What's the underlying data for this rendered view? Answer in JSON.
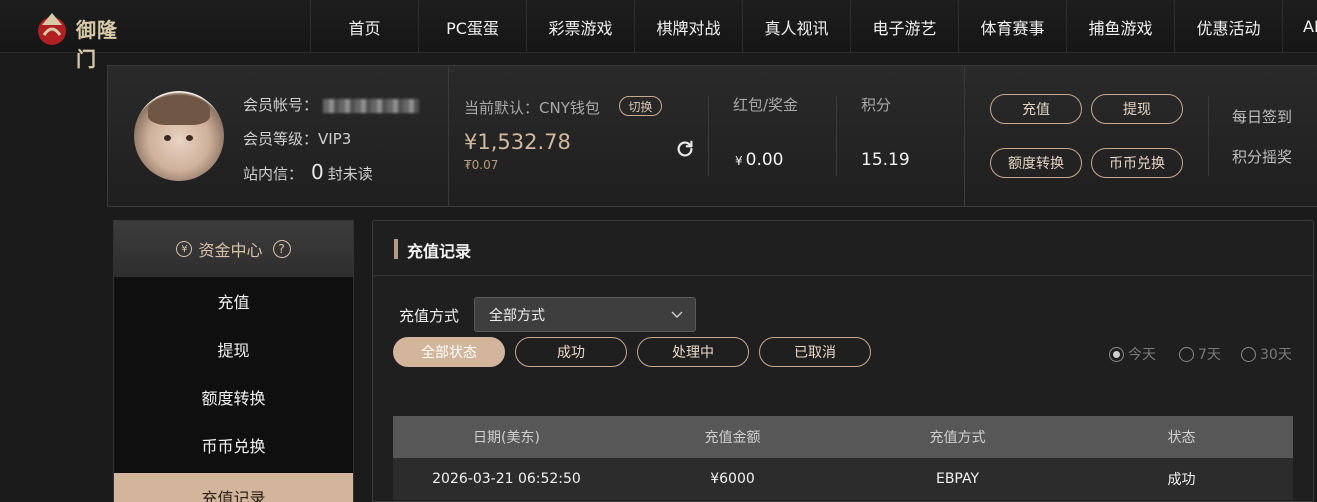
{
  "brand": {
    "name": "御隆门"
  },
  "nav": {
    "items": [
      "首页",
      "PC蛋蛋",
      "彩票游戏",
      "棋牌对战",
      "真人视讯",
      "电子游艺",
      "体育赛事",
      "捕鱼游戏",
      "优惠活动",
      "AI"
    ]
  },
  "account": {
    "member_id_label": "会员帐号：",
    "level_label": "会员等级：",
    "level_value": "VIP3",
    "inbox_label": "站内信：",
    "inbox_count": "0",
    "inbox_suffix": "封未读",
    "wallet_label": "当前默认：CNY钱包",
    "switch_label": "切换",
    "balance": "¥1,532.78",
    "sub_balance": "₮0.07",
    "bonus_label": "红包/奖金",
    "bonus_currency": "¥",
    "bonus_value": "0.00",
    "points_label": "积分",
    "points_value": "15.19",
    "actions": {
      "deposit": "充值",
      "withdraw": "提现",
      "transfer": "额度转换",
      "exchange": "币币兑换"
    },
    "daily_checkin": "每日签到",
    "points_lottery": "积分摇奖"
  },
  "sidebar": {
    "header": "资金中心",
    "items": [
      "充值",
      "提现",
      "额度转换",
      "币币兑换",
      "充值记录"
    ],
    "active_index": 4
  },
  "main": {
    "title": "充值记录",
    "method_label": "充值方式",
    "method_selected": "全部方式",
    "status_filters": [
      "全部状态",
      "成功",
      "处理中",
      "已取消"
    ],
    "active_status_index": 0,
    "date_ranges": [
      "今天",
      "7天",
      "30天"
    ],
    "selected_range_index": 0,
    "table": {
      "headers": [
        "日期(美东)",
        "充值金额",
        "充值方式",
        "状态"
      ],
      "rows": [
        [
          "2026-03-21 06:52:50",
          "¥6000",
          "EBPAY",
          "成功"
        ]
      ]
    }
  },
  "colors": {
    "accent": "#d2b59a",
    "background": "#1b1b1b",
    "panel": "#1f1f1f",
    "table_header": "#575757"
  },
  "icons": {
    "refresh": "refresh-icon",
    "yuan": "yuan-circle-icon",
    "help": "help-icon",
    "chevron": "chevron-down-icon"
  }
}
